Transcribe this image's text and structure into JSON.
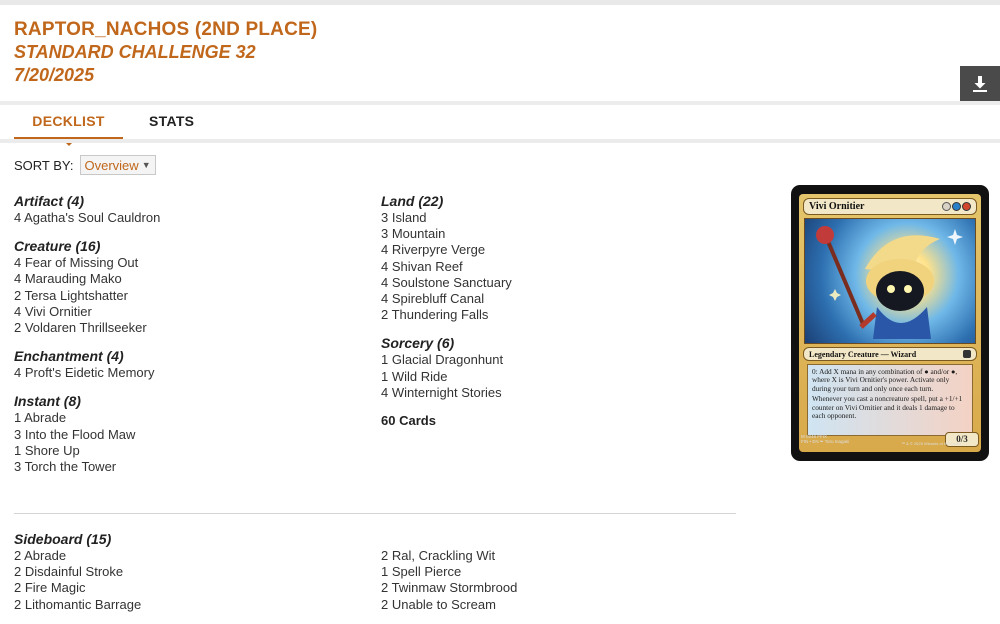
{
  "deck": {
    "title": "RAPTOR_NACHOS (2ND PLACE)",
    "event": "STANDARD CHALLENGE 32",
    "date": "7/20/2025"
  },
  "tabs": [
    {
      "label": "DECKLIST",
      "active": true
    },
    {
      "label": "STATS",
      "active": false
    }
  ],
  "sort": {
    "label": "SORT BY:",
    "selected": "Overview"
  },
  "mainboard": {
    "left": [
      {
        "title": "Artifact (4)",
        "cards": [
          "4 Agatha's Soul Cauldron"
        ]
      },
      {
        "title": "Creature (16)",
        "cards": [
          "4 Fear of Missing Out",
          "4 Marauding Mako",
          "2 Tersa Lightshatter",
          "4 Vivi Ornitier",
          "2 Voldaren Thrillseeker"
        ]
      },
      {
        "title": "Enchantment (4)",
        "cards": [
          "4 Proft's Eidetic Memory"
        ]
      },
      {
        "title": "Instant (8)",
        "cards": [
          "1 Abrade",
          "3 Into the Flood Maw",
          "1 Shore Up",
          "3 Torch the Tower"
        ]
      }
    ],
    "right": [
      {
        "title": "Land (22)",
        "cards": [
          "3 Island",
          "3 Mountain",
          "4 Riverpyre Verge",
          "4 Shivan Reef",
          "4 Soulstone Sanctuary",
          "4 Spirebluff Canal",
          "2 Thundering Falls"
        ]
      },
      {
        "title": "Sorcery (6)",
        "cards": [
          "1 Glacial Dragonhunt",
          "1 Wild Ride",
          "4 Winternight Stories"
        ]
      }
    ],
    "total": "60 Cards"
  },
  "sideboard": {
    "title": "Sideboard (15)",
    "left": [
      "2 Abrade",
      "2 Disdainful Stroke",
      "2 Fire Magic",
      "2 Lithomantic Barrage"
    ],
    "right": [
      "2 Ral, Crackling Wit",
      "1 Spell Pierce",
      "2 Twinmaw Stormbrood",
      "2 Unable to Scream"
    ]
  },
  "card_preview": {
    "name": "Vivi Ornitier",
    "type_line": "Legendary Creature — Wizard",
    "rules": [
      "0: Add X mana in any combination of ● and/or ●, where X is Vivi Ornitier's power. Activate only during your turn and only once each turn.",
      "Whenever you cast a noncreature spell, put a +1/+1 counter on Vivi Ornitier and it deals 1 damage to each opponent."
    ],
    "power_toughness": "0/3",
    "footer_left": [
      "M 0248 FFIX",
      "FIN • EN ✒ Toru Inagaki"
    ],
    "footer_right": "™ & © 2025 Wizards of the Coast",
    "mana_colors": [
      "#d9d2c5",
      "#2a7fc9",
      "#d2452d"
    ]
  }
}
